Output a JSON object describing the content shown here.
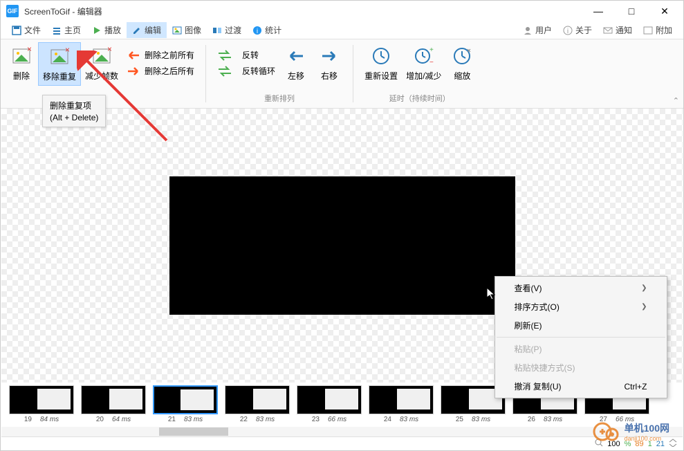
{
  "app": {
    "icon_text": "GIF",
    "title": "ScreenToGif - 编辑器"
  },
  "window": {
    "min": "—",
    "max": "□",
    "close": "✕"
  },
  "menu": {
    "file": "文件",
    "home": "主页",
    "play": "播放",
    "edit": "编辑",
    "image": "图像",
    "transition": "过渡",
    "stats": "统计",
    "user": "用户",
    "about": "关于",
    "notify": "通知",
    "attach": "附加"
  },
  "ribbon": {
    "delete": "删除",
    "remove_dup": "移除重复",
    "reduce_frames": "减少帧数",
    "del_before": "删除之前所有",
    "del_after": "删除之后所有",
    "reverse": "反转",
    "rev_loop": "反转循环",
    "move_left": "左移",
    "move_right": "右移",
    "reset": "重新设置",
    "inc_dec": "增加/减少",
    "scale": "缩放",
    "group_rearrange": "重新排列",
    "group_delay": "延时（持续时间）"
  },
  "tooltip": {
    "title": "删除重复项",
    "shortcut": "(Alt + Delete)"
  },
  "context": {
    "view": "查看(V)",
    "sort": "排序方式(O)",
    "refresh": "刷新(E)",
    "paste": "粘贴(P)",
    "paste_shortcut": "粘贴快捷方式(S)",
    "undo_copy": "撤消 复制(U)",
    "undo_key": "Ctrl+Z"
  },
  "thumbs": [
    {
      "n": "19",
      "ms": "84 ms"
    },
    {
      "n": "20",
      "ms": "64 ms"
    },
    {
      "n": "21",
      "ms": "83 ms",
      "selected": true
    },
    {
      "n": "22",
      "ms": "83 ms"
    },
    {
      "n": "23",
      "ms": "66 ms"
    },
    {
      "n": "24",
      "ms": "83 ms"
    },
    {
      "n": "25",
      "ms": "83 ms"
    },
    {
      "n": "26",
      "ms": "83 ms"
    },
    {
      "n": "27",
      "ms": "66 ms"
    }
  ],
  "status": {
    "zoom": "100",
    "pct": "%",
    "total": "89",
    "sel_count": "1",
    "current": "21"
  },
  "watermark": {
    "text": "单机100网",
    "sub": "danji100.com"
  }
}
